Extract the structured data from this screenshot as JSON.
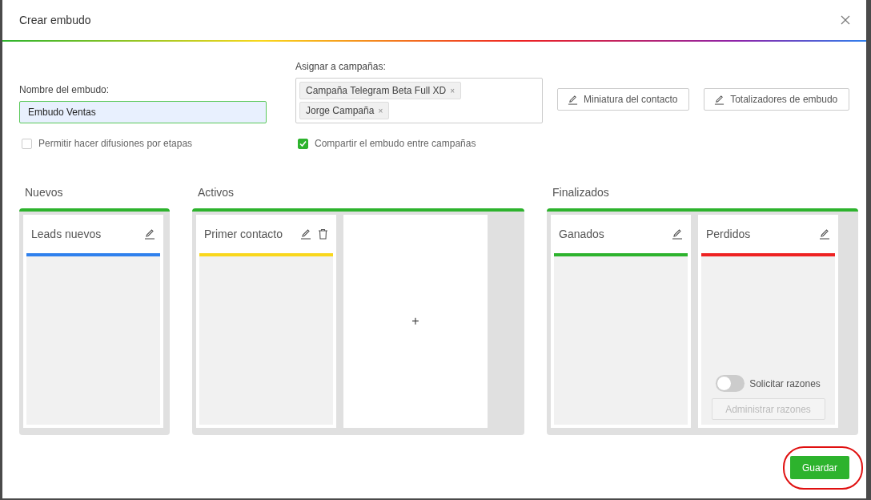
{
  "dialog": {
    "title": "Crear embudo"
  },
  "name_field": {
    "label": "Nombre del embudo:",
    "value": "Embudo Ventas"
  },
  "campaigns": {
    "label": "Asignar a campañas:",
    "tags": [
      {
        "text": "Campaña Telegram Beta Full XD",
        "remove": "×"
      },
      {
        "text": "Jorge Campaña",
        "remove": "×"
      }
    ]
  },
  "buttons": [
    "Miniatura del contacto",
    "Totalizadores de embudo"
  ],
  "options": [
    {
      "label": "Permitir hacer difusiones por etapas",
      "checked": false
    },
    {
      "label": "Compartir el embudo entre campañas",
      "checked": true
    }
  ],
  "groups": [
    {
      "title": "Nuevos",
      "stages": [
        {
          "kind": "stage",
          "name": "Leads nuevos",
          "color": "#2f80ed",
          "deletable": false
        }
      ]
    },
    {
      "title": "Activos",
      "stages": [
        {
          "kind": "stage",
          "name": "Primer contacto",
          "color": "#f9d71c",
          "deletable": true
        },
        {
          "kind": "add",
          "name": "+"
        }
      ]
    },
    {
      "title": "Finalizados",
      "stages": [
        {
          "kind": "stage",
          "name": "Ganados",
          "color": "#2db32d",
          "deletable": false
        },
        {
          "kind": "stage",
          "name": "Perdidos",
          "color": "#ee2222",
          "deletable": false,
          "reasons": {
            "toggle": "Solicitar razones",
            "on": false,
            "button": "Administrar razones"
          }
        }
      ]
    }
  ],
  "save": "Guardar"
}
